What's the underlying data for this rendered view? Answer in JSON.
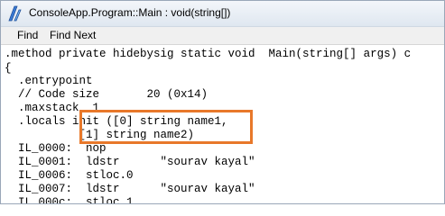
{
  "window": {
    "title": "ConsoleApp.Program::Main : void(string[])",
    "icon": "ildasm-app-icon"
  },
  "menu": {
    "find": "Find",
    "find_next": "Find Next"
  },
  "code": {
    "lines": [
      ".method private hidebysig static void  Main(string[] args) c",
      "{",
      "  .entrypoint",
      "  // Code size       20 (0x14)",
      "  .maxstack  1",
      "  .locals init ([0] string name1,",
      "           [1] string name2)",
      "  IL_0000:  nop",
      "  IL_0001:  ldstr      \"sourav kayal\"",
      "  IL_0006:  stloc.0",
      "  IL_0007:  ldstr      \"sourav kayal\"",
      "  IL_000c:  stloc.1"
    ]
  },
  "highlight_color": "#e8782a"
}
